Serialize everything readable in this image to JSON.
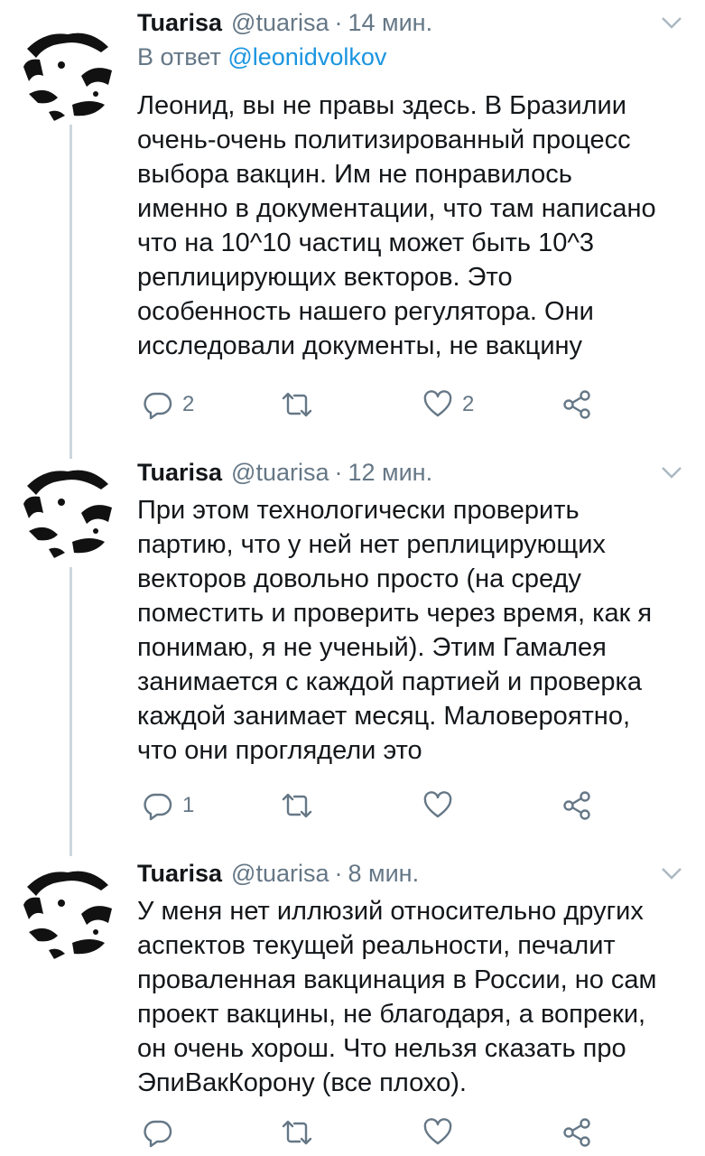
{
  "tweets": [
    {
      "name": "Tuarisa",
      "handle": "@tuarisa",
      "separator": "·",
      "time": "14 мин.",
      "reply_prefix": "В ответ",
      "reply_mention": "@leonidvolkov",
      "lines": [
        "Леонид, вы не правы здесь. В Бразилии",
        "очень-очень политизированный процесс",
        "выбора вакцин. Им не понравилось",
        "именно в документации, что там написано",
        "что на 10^10 частиц может быть 10^3",
        "реплицирующих векторов. Это",
        "особенность нашего регулятора. Они",
        "исследовали документы, не вакцину"
      ],
      "replies": "2",
      "retweets": "",
      "likes": "2"
    },
    {
      "name": "Tuarisa",
      "handle": "@tuarisa",
      "separator": "·",
      "time": "12 мин.",
      "lines": [
        "При этом технологически проверить",
        "партию, что у ней нет реплицирующих",
        "векторов довольно просто (на среду",
        "поместить и проверить через время, как я",
        "понимаю, я не ученый). Этим Гамалея",
        "занимается с каждой партией и проверка",
        "каждой занимает месяц. Маловероятно,",
        "что они проглядели это"
      ],
      "replies": "1",
      "retweets": "",
      "likes": ""
    },
    {
      "name": "Tuarisa",
      "handle": "@tuarisa",
      "separator": "·",
      "time": "8 мин.",
      "lines": [
        "У меня нет иллюзий относительно других",
        "аспектов текущей реальности, печалит",
        "проваленная вакцинация в России, но сам",
        "проект вакцины, не благодаря, а вопреки,",
        "он очень хорош. Что нельзя сказать про",
        "ЭпиВакКорону (все плохо)."
      ],
      "replies": "",
      "retweets": "",
      "likes": ""
    }
  ],
  "icons": {
    "reply": "reply-icon",
    "retweet": "retweet-icon",
    "like": "like-icon",
    "share": "share-icon",
    "caret": "chevron-down-icon"
  },
  "colors": {
    "text": "#14171a",
    "secondary": "#657786",
    "link": "#1b95e0",
    "thread_line": "#ccd6dd"
  }
}
